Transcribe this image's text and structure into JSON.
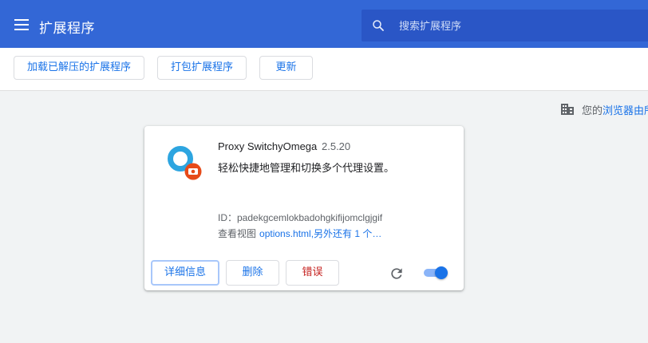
{
  "header": {
    "title": "扩展程序",
    "search_placeholder": "搜索扩展程序"
  },
  "toolbar": {
    "load_unpacked": "加载已解压的扩展程序",
    "pack_extension": "打包扩展程序",
    "update": "更新"
  },
  "managed_notice": {
    "prefix": "您的",
    "link": "浏览器由所"
  },
  "extension": {
    "name": "Proxy SwitchyOmega",
    "version": "2.5.20",
    "description": "轻松快捷地管理和切换多个代理设置。",
    "id": "ID：padekgcemlokbadohgkifijomclgjgif",
    "views_label": "查看视图",
    "views_link": "options.html,另外还有 1 个…",
    "details_button": "详细信息",
    "remove_button": "删除",
    "errors_button": "错误",
    "enabled": true
  },
  "colors": {
    "header": "#3367d6",
    "search_bg": "#2a56c6",
    "accent": "#1a73e8",
    "error": "#c5221f",
    "icon_blue": "#2da5e0",
    "icon_badge": "#e64a19"
  }
}
